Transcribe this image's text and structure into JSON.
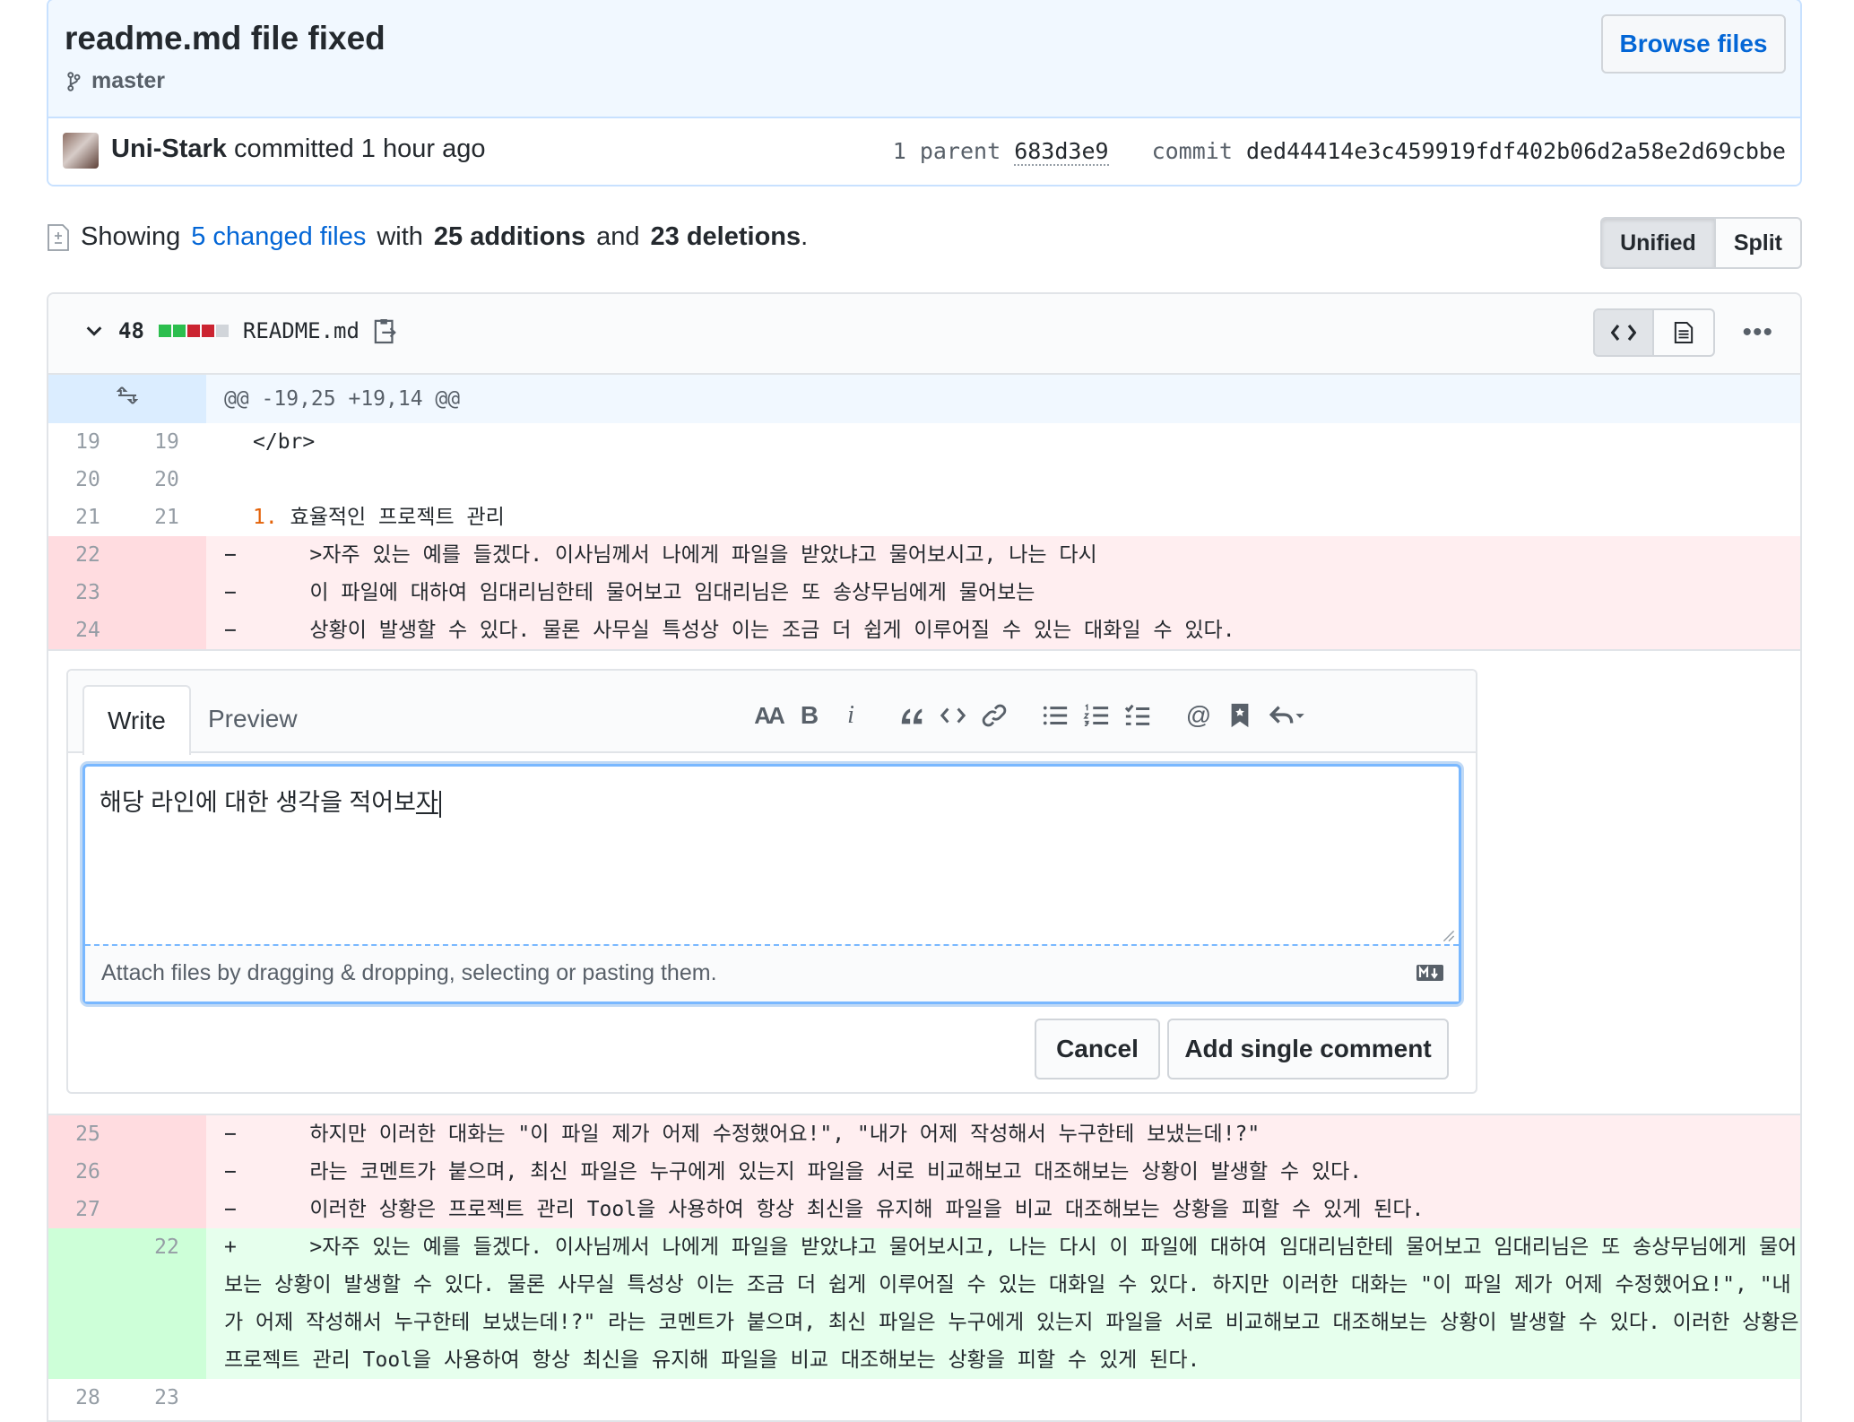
{
  "commit": {
    "title": "readme.md file fixed",
    "branch": "master",
    "browse_label": "Browse files",
    "author": "Uni-Stark",
    "action_text": "committed 1 hour ago",
    "parent_label": "1 parent",
    "parent_sha": "683d3e9",
    "commit_label": "commit",
    "commit_sha": "ded44414e3c459919fdf402b06d2a58e2d69cbbe"
  },
  "summary": {
    "showing": "Showing",
    "changed_files": "5 changed files",
    "with": "with",
    "additions": "25 additions",
    "and": "and",
    "deletions": "23 deletions",
    "period": "."
  },
  "view_toggle": {
    "unified": "Unified",
    "split": "Split",
    "selected": "Unified"
  },
  "file": {
    "change_count": "48",
    "change_blocks": [
      "add",
      "add",
      "del",
      "del",
      "neutral"
    ],
    "name": "README.md"
  },
  "diff": {
    "hunk_header": "@@ -19,25 +19,14 @@",
    "context_before": [
      {
        "old": "19",
        "new": "19",
        "text": "</br>"
      },
      {
        "old": "20",
        "new": "20",
        "text": ""
      },
      {
        "old": "21",
        "new": "21",
        "marker": "1.",
        "text": " 효율적인 프로젝트 관리"
      }
    ],
    "deleted_before": [
      {
        "old": "22",
        "sign": "−",
        "text": "    >자주 있는 예를 들겠다. 이사님께서 나에게 파일을 받았냐고 물어보시고, 나는 다시"
      },
      {
        "old": "23",
        "sign": "−",
        "text": "    이 파일에 대하여 임대리님한테 물어보고 임대리님은 또 송상무님에게 물어보는"
      },
      {
        "old": "24",
        "sign": "−",
        "text": "    상황이 발생할 수 있다. 물론 사무실 특성상 이는 조금 더 쉽게 이루어질 수 있는 대화일 수 있다."
      }
    ],
    "deleted_after": [
      {
        "old": "25",
        "sign": "−",
        "text": "    하지만 이러한 대화는 \"이 파일 제가 어제 수정했어요!\", \"내가 어제 작성해서 누구한테 보냈는데!?\""
      },
      {
        "old": "26",
        "sign": "−",
        "text": "    라는 코멘트가 붙으며, 최신 파일은 누구에게 있는지 파일을 서로 비교해보고 대조해보는 상황이 발생할 수 있다."
      },
      {
        "old": "27",
        "sign": "−",
        "text": "    이러한 상황은 프로젝트 관리 Tool을 사용하여 항상 최신을 유지해 파일을 비교 대조해보는 상황을 피할 수 있게 된다."
      }
    ],
    "added": {
      "new": "22",
      "sign": "+",
      "text": "    >자주 있는 예를 들겠다. 이사님께서 나에게 파일을 받았냐고 물어보시고, 나는 다시 이 파일에 대하여 임대리님한테 물어보고 임대리님은 또 송상무님에게 물어보는 상황이 발생할 수 있다. 물론 사무실 특성상 이는 조금 더 쉽게 이루어질 수 있는 대화일 수 있다. 하지만 이러한 대화는 \"이 파일 제가 어제 수정했어요!\", \"내가 어제 작성해서 누구한테 보냈는데!?\" 라는 코멘트가 붙으며, 최신 파일은 누구에게 있는지 파일을 서로 비교해보고 대조해보는 상황이 발생할 수 있다. 이러한 상황은 프로젝트 관리 Tool을 사용하여 항상 최신을 유지해 파일을 비교 대조해보는 상황을 피할 수 있게 된다."
    },
    "context_after": [
      {
        "old": "28",
        "new": "23",
        "text": ""
      }
    ]
  },
  "comment_form": {
    "tab_write": "Write",
    "tab_preview": "Preview",
    "toolbar_heading": "AA",
    "toolbar_bold": "B",
    "toolbar_italic": "i",
    "toolbar_mention": "@",
    "editor_value": "해당 라인에 대한 생각을 적어보",
    "editor_composing": "자",
    "attach_hint": "Attach files by dragging & dropping, selecting or pasting them.",
    "cancel_label": "Cancel",
    "submit_label": "Add single comment"
  },
  "colors": {
    "link": "#0366d6",
    "del_bg": "#ffeef0",
    "add_bg": "#e6ffed",
    "hunk_bg": "#f1f8ff",
    "block_add": "#2cbe4e",
    "block_del": "#cb2431"
  }
}
